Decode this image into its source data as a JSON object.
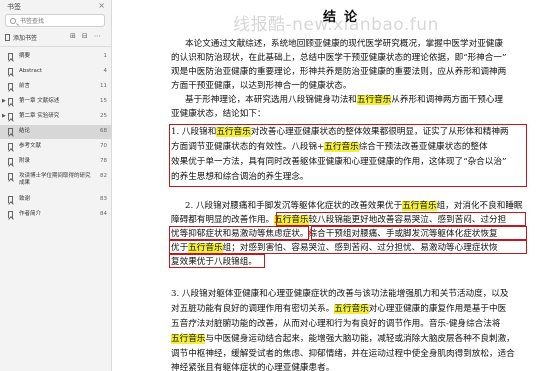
{
  "sidebar": {
    "title": "书签",
    "search_placeholder": "书签查找",
    "add_bookmark_label": "添加书签",
    "items": [
      {
        "label": "摘要",
        "page": "1"
      },
      {
        "label": "Abstract",
        "page": "4"
      },
      {
        "label": "前言",
        "page": "11"
      },
      {
        "label": "第一章 文献综述",
        "page": "15"
      },
      {
        "label": "第二章 实验研究",
        "page": "25"
      },
      {
        "label": "结论",
        "page": "68"
      },
      {
        "label": "参考文献",
        "page": "70"
      },
      {
        "label": "附录",
        "page": "78"
      },
      {
        "label": "攻读博士学位期间取得的研究成果",
        "page": "82"
      },
      {
        "label": "致谢",
        "page": "83"
      },
      {
        "label": "作者简介",
        "page": "84"
      }
    ]
  },
  "watermark": "线报酷-new.xianbao.fun",
  "doc": {
    "title": "结论",
    "lines": [
      {
        "segments": [
          {
            "t": "本论文通过文献综述，系统地回顾亚健康的现代医学研究概况，掌握中医学对亚健康"
          }
        ]
      },
      {
        "segments": [
          {
            "t": "的认识和防治现状，在此基础上，总结中医学干预亚健康状态的理论依据，即“形神合一”"
          }
        ]
      },
      {
        "segments": [
          {
            "t": "观是中医防治亚健康的重要理论，形神共养是防治亚健康的重要法则，应从养形和调神两"
          }
        ]
      },
      {
        "segments": [
          {
            "t": "方面干预亚健康，以达到形神合一的健康状态。"
          }
        ]
      },
      {
        "segments": [
          {
            "t": "基于形神理论，本研究选用八段锦健身功法和"
          },
          {
            "t": "五行音乐",
            "hl": true
          },
          {
            "t": "从养形和调神两方面干预心理"
          }
        ]
      },
      {
        "segments": [
          {
            "t": "亚健康状态，结论如下："
          }
        ]
      },
      {
        "segments": [
          {
            "t": "1. 八段锦和"
          },
          {
            "t": "五行音乐",
            "hl": true
          },
          {
            "t": "对改善心理亚健康状态的整体效果都很明显，证实了从形体和精神两"
          }
        ]
      },
      {
        "segments": [
          {
            "t": "方面调节亚健康状态的有效性。八段锦+"
          },
          {
            "t": "五行音乐",
            "hl": true
          },
          {
            "t": "综合干预法改善亚健康状态的整体"
          }
        ]
      },
      {
        "segments": [
          {
            "t": "效果优于单一方法，具有同时改善躯体亚健康和心理亚健康的作用，这体现了“杂合以治”"
          }
        ]
      },
      {
        "segments": [
          {
            "t": "的养生思想和综合调治的养生理念。"
          }
        ]
      },
      {
        "segments": [
          {
            "t": "2. 八段锦对腰痛和手脚发沉等躯体化症状的改善效果优于"
          },
          {
            "t": "五行音乐",
            "hl": true
          },
          {
            "t": "组，对消化不良和睡眠"
          }
        ]
      },
      {
        "segments": [
          {
            "t": "障碍都有明显的改善作用。"
          },
          {
            "t": "五行音乐",
            "hl": true
          },
          {
            "t": "较八段锦能更好地改善容易哭泣、感到苦闷、过分担"
          }
        ]
      },
      {
        "segments": [
          {
            "t": "忧等抑郁症状和易激动等焦虑症状。综合干预组对腰痛、手或脚发沉等躯体化症状恢复"
          }
        ]
      },
      {
        "segments": [
          {
            "t": "优于"
          },
          {
            "t": "五行音乐",
            "hl": true
          },
          {
            "t": "组；对感到害怕、容易哭泣、感到苦闷、过分担忧、易激动等心理症状恢"
          }
        ]
      },
      {
        "segments": [
          {
            "t": "复效果优于八段锦组。"
          }
        ]
      },
      {
        "segments": [
          {
            "t": "3. 八段锦对躯体亚健康和心理亚健康症状的改善与该功法能增强肌力和关节活动度，以及"
          }
        ]
      },
      {
        "segments": [
          {
            "t": "对五脏功能有良好的调理作用有密切关系。"
          },
          {
            "t": "五行音乐",
            "hl": true
          },
          {
            "t": "对心理亚健康的康复作用是基于中医"
          }
        ]
      },
      {
        "segments": [
          {
            "t": "五音疗法对脏腑功能的改善，从而对心理和行为有良好的调节作用。音乐-健身综合法将"
          }
        ]
      },
      {
        "segments": [
          {
            "t": "五行音乐",
            "hl": true
          },
          {
            "t": "与中医健身运动结合起来，能增强大脑功能，减轻或消除大脑皮层各种不良刺激，"
          }
        ]
      },
      {
        "segments": [
          {
            "t": "调节中枢神经，缓解受试者的焦虑、抑郁情绪，并在运动过程中使全身肌肉得到放松，适合"
          }
        ]
      },
      {
        "segments": [
          {
            "t": "神经紧张且有躯体症状的心理亚健康患者。"
          }
        ]
      }
    ]
  }
}
